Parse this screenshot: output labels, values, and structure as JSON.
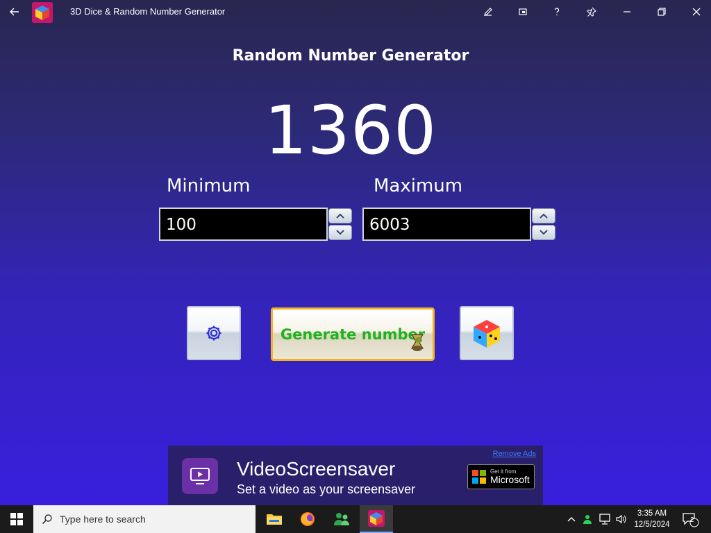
{
  "window": {
    "title": "3D Dice & Random Number Generator"
  },
  "main": {
    "heading": "Random Number Generator",
    "result": "1360",
    "minimum_label": "Minimum",
    "maximum_label": "Maximum",
    "minimum_value": "100",
    "maximum_value": "6003",
    "generate_label": "Generate number"
  },
  "ad": {
    "title": "VideoScreensaver",
    "subtitle": "Set a video as your screensaver",
    "remove_ads": "Remove Ads",
    "store_line1": "Get it from",
    "store_line2": "Microsoft"
  },
  "taskbar": {
    "search_placeholder": "Type here to search",
    "time": "3:35 AM",
    "date": "12/5/2024",
    "notification_count": "2"
  },
  "colors": {
    "accent_orange": "#f3b31f",
    "generate_text": "#1fb31f",
    "link_blue": "#3b7bff"
  }
}
